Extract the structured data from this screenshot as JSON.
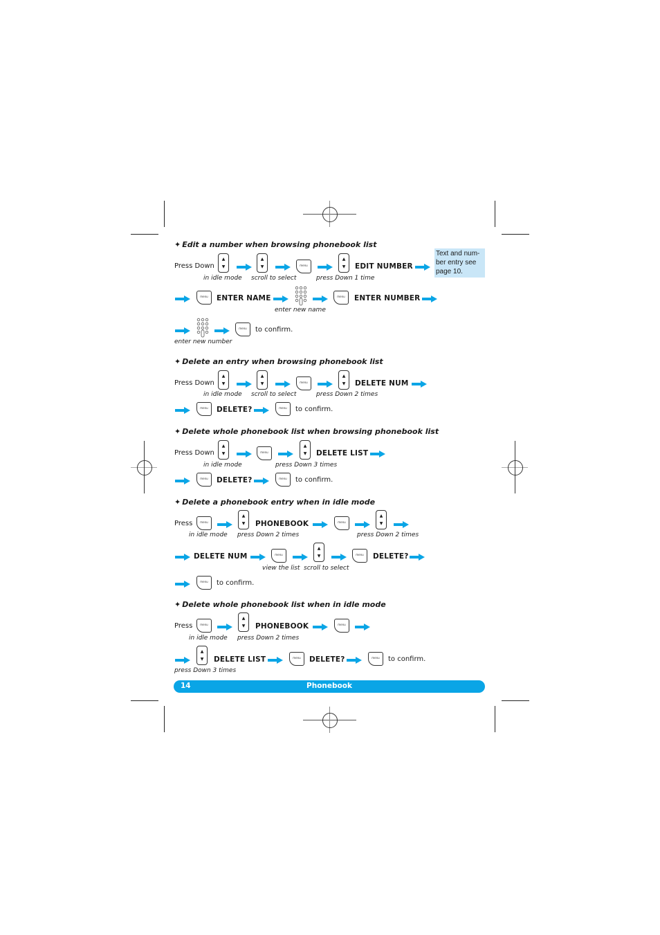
{
  "colors": {
    "accent": "#0aa5e6",
    "note_bg": "#c9e6f7",
    "text": "#1a1a1a"
  },
  "icons": {
    "arrow": "arrow-right-icon",
    "nav": "navigation-key-icon",
    "menu": "menu-key-icon",
    "keypad": "keypad-icon"
  },
  "menu_key_label": "menu",
  "side_note": {
    "lines": [
      "Text and num-",
      "ber entry see",
      "page 10."
    ]
  },
  "sections": [
    {
      "heading": "Edit a number when browsing phonebook list",
      "press_down": "Press Down",
      "idle_caption": "in idle mode",
      "scroll_caption": "scroll to select",
      "down_caption": "press Down 1 time",
      "cmd1": "EDIT NUMBER",
      "cmd2": "ENTER NAME",
      "name_caption": "enter new name",
      "cmd3": "ENTER NUMBER",
      "number_caption": "enter new number",
      "confirm": "to confirm."
    },
    {
      "heading": "Delete an entry when browsing phonebook list",
      "press_down": "Press Down",
      "idle_caption": "in idle mode",
      "scroll_caption": "scroll to select",
      "down_caption": "press Down 2 times",
      "cmd1": "DELETE NUM",
      "cmd2": "DELETE?",
      "confirm": "to confirm."
    },
    {
      "heading": "Delete whole phonebook list when browsing phonebook list",
      "press_down": "Press Down",
      "idle_caption": "in idle mode",
      "down_caption": "press Down 3 times",
      "cmd1": "DELETE LIST",
      "cmd2": "DELETE?",
      "confirm": "to confirm."
    },
    {
      "heading": "Delete a phonebook entry when in idle mode",
      "press": "Press",
      "idle_caption": "in idle mode",
      "down_caption": "press Down 2 times",
      "cmd1": "PHONEBOOK",
      "down_caption2": "press Down 2 times",
      "cmd2": "DELETE NUM",
      "view_caption": "view the list",
      "scroll_caption": "scroll to select",
      "cmd3": "DELETE?",
      "confirm": "to confirm."
    },
    {
      "heading": "Delete whole phonebook list when in idle mode",
      "press": "Press",
      "idle_caption": "in idle mode",
      "down_caption": "press Down 2 times",
      "cmd1": "PHONEBOOK",
      "cmd2": "DELETE LIST",
      "down_caption3": "press Down 3 times",
      "cmd3": "DELETE?",
      "confirm": "to confirm."
    }
  ],
  "footer": {
    "page_number": "14",
    "title": "Phonebook"
  }
}
